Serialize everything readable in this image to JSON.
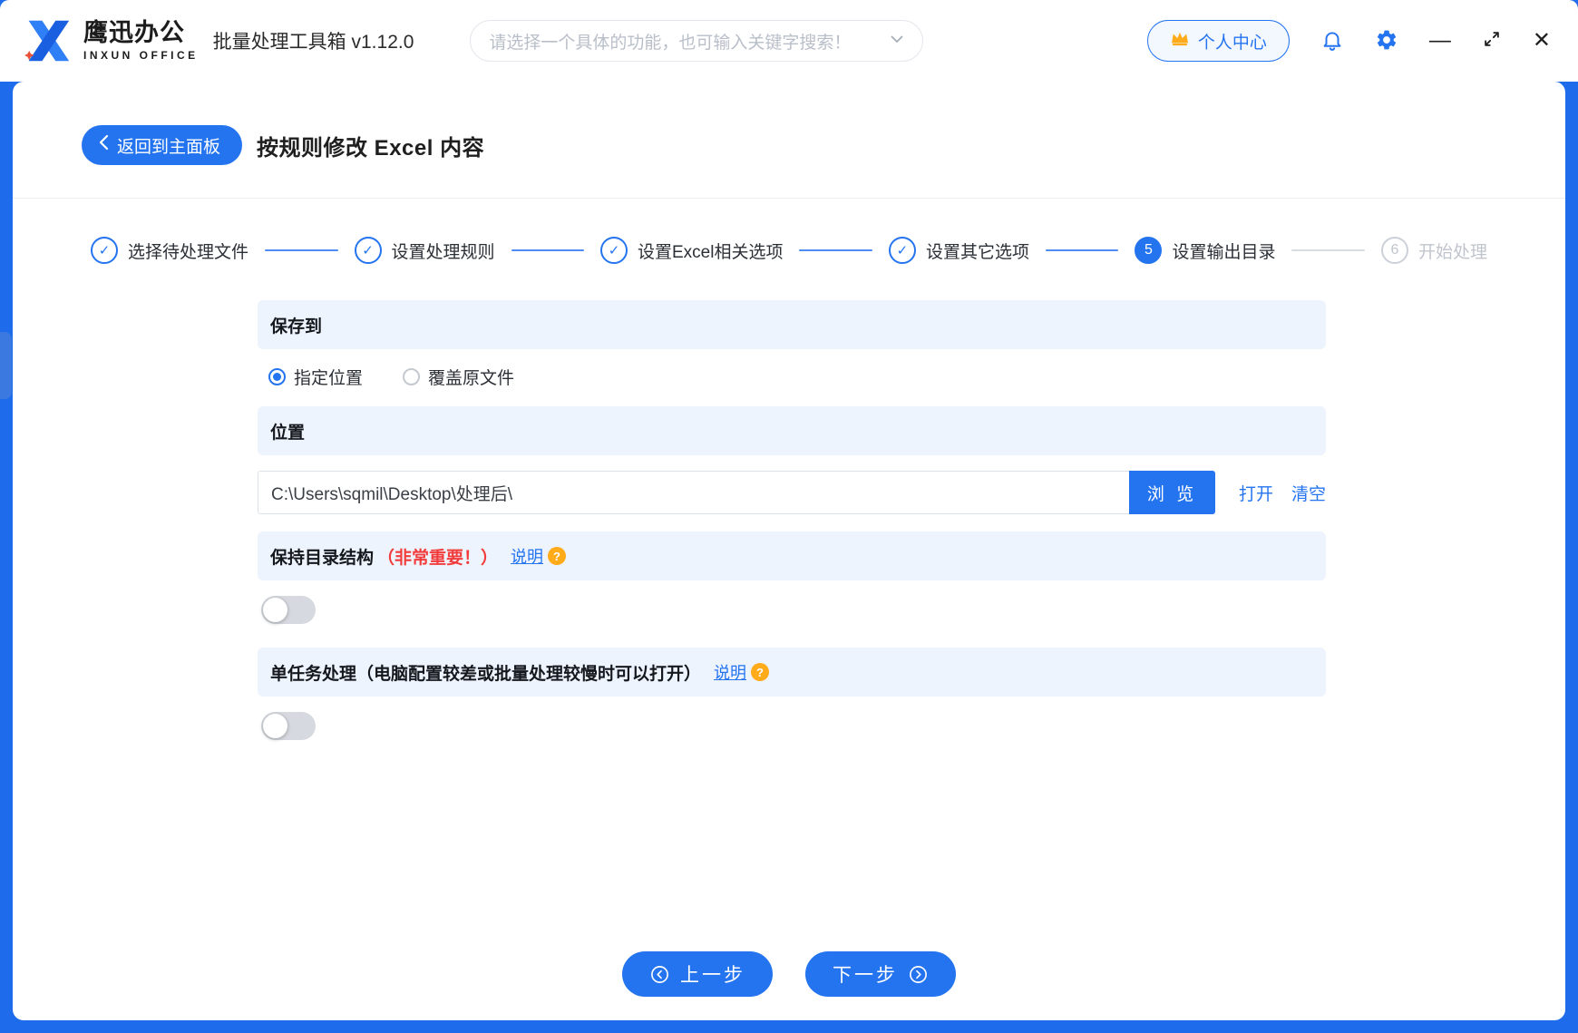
{
  "colors": {
    "primary": "#2474f0",
    "frame": "#1e6ceb",
    "section_bg": "#eef4fd",
    "red": "#f23c3c",
    "orange": "#ffab1a"
  },
  "icons": {
    "check": "✓",
    "minimize": "—",
    "close": "✕",
    "question": "?"
  },
  "topbar": {
    "brand": {
      "name": "鹰迅办公",
      "subtitle": "INXUN OFFICE"
    },
    "app_title": "批量处理工具箱 v1.12.0",
    "search": {
      "placeholder": "请选择一个具体的功能，也可输入关键字搜索！"
    },
    "user_center_label": "个人中心"
  },
  "page": {
    "back_label": "返回到主面板",
    "title": "按规则修改 Excel 内容"
  },
  "stepper": {
    "steps": [
      {
        "label": "选择待处理文件",
        "state": "done"
      },
      {
        "label": "设置处理规则",
        "state": "done"
      },
      {
        "label": "设置Excel相关选项",
        "state": "done"
      },
      {
        "label": "设置其它选项",
        "state": "done"
      },
      {
        "label": "设置输出目录",
        "state": "current",
        "number": "5"
      },
      {
        "label": "开始处理",
        "state": "todo",
        "number": "6"
      }
    ]
  },
  "form": {
    "save_to": {
      "title": "保存到",
      "options": [
        {
          "label": "指定位置",
          "selected": true
        },
        {
          "label": "覆盖原文件",
          "selected": false
        }
      ]
    },
    "location": {
      "title": "位置",
      "path_value": "C:\\Users\\sqmil\\Desktop\\处理后\\",
      "browse_label": "浏 览",
      "open_label": "打开",
      "clear_label": "清空"
    },
    "keep_structure": {
      "title": "保持目录结构",
      "important": "（非常重要！）",
      "help_label": "说明",
      "enabled": false
    },
    "single_task": {
      "title": "单任务处理（电脑配置较差或批量处理较慢时可以打开）",
      "help_label": "说明",
      "enabled": false
    }
  },
  "footer": {
    "prev_label": "上一步",
    "next_label": "下一步"
  }
}
